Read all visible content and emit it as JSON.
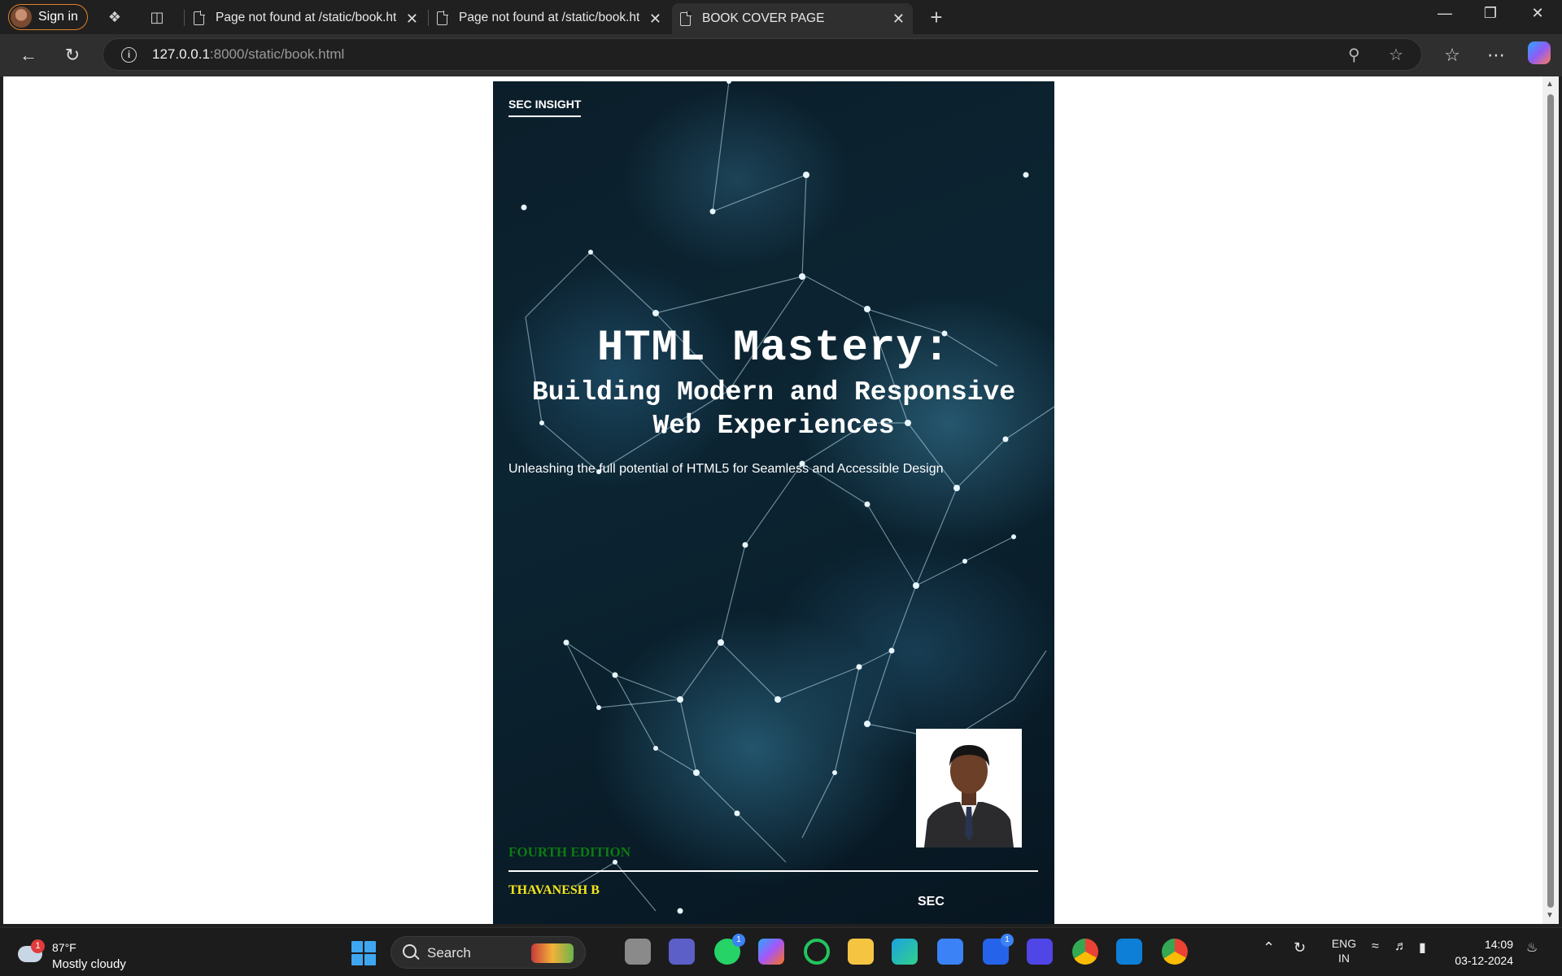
{
  "browser": {
    "signin_label": "Sign in",
    "tabs": [
      {
        "title": "Page not found at /static/book.html"
      },
      {
        "title": "Page not found at /static/book.html"
      },
      {
        "title": "BOOK COVER PAGE"
      }
    ],
    "url_host": "127.0.0.1",
    "url_rest": ":8000/static/book.html"
  },
  "cover": {
    "publisher": "SEC INSIGHT",
    "title": "HTML Mastery:",
    "subtitle_line1": "Building Modern and Responsive",
    "subtitle_line2": "Web Experiences",
    "tagline": "Unleashing the full potential of HTML5 for Seamless and Accessible Design",
    "edition": "FOURTH EDITION",
    "author": "THAVANESH B",
    "institution": "SEC"
  },
  "taskbar": {
    "weather_temp": "87°F",
    "weather_desc": "Mostly cloudy",
    "weather_badge": "1",
    "search_label": "Search",
    "whatsapp_badge": "1",
    "l_app_badge": "1",
    "lang_line1": "ENG",
    "lang_line2": "IN",
    "time": "14:09",
    "date": "03-12-2024"
  }
}
